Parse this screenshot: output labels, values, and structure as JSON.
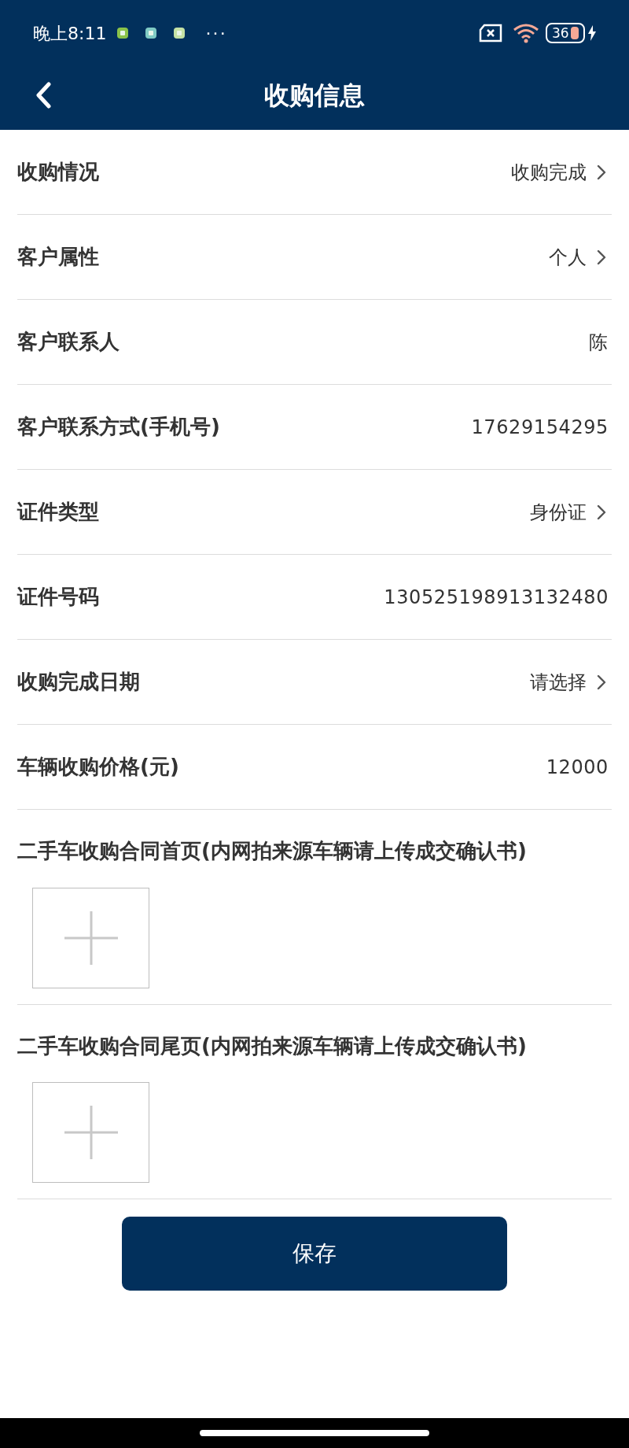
{
  "status_bar": {
    "time": "晚上8:11",
    "more": "···",
    "battery": "36"
  },
  "header": {
    "title": "收购信息"
  },
  "fields": [
    {
      "label": "收购情况",
      "value": "收购完成",
      "kind": "select"
    },
    {
      "label": "客户属性",
      "value": "个人",
      "kind": "select"
    },
    {
      "label": "客户联系人",
      "value": "陈",
      "kind": "text"
    },
    {
      "label": "客户联系方式(手机号)",
      "value": "17629154295",
      "kind": "text"
    },
    {
      "label": "证件类型",
      "value": "身份证",
      "kind": "select"
    },
    {
      "label": "证件号码",
      "value": "130525198913132480",
      "kind": "text"
    },
    {
      "label": "收购完成日期",
      "value": "请选择",
      "kind": "select"
    },
    {
      "label": "车辆收购价格(元)",
      "value": "12000",
      "kind": "text"
    }
  ],
  "uploads": [
    {
      "label": "二手车收购合同首页(内网拍来源车辆请上传成交确认书)"
    },
    {
      "label": "二手车收购合同尾页(内网拍来源车辆请上传成交确认书)"
    }
  ],
  "save_button": "保存"
}
